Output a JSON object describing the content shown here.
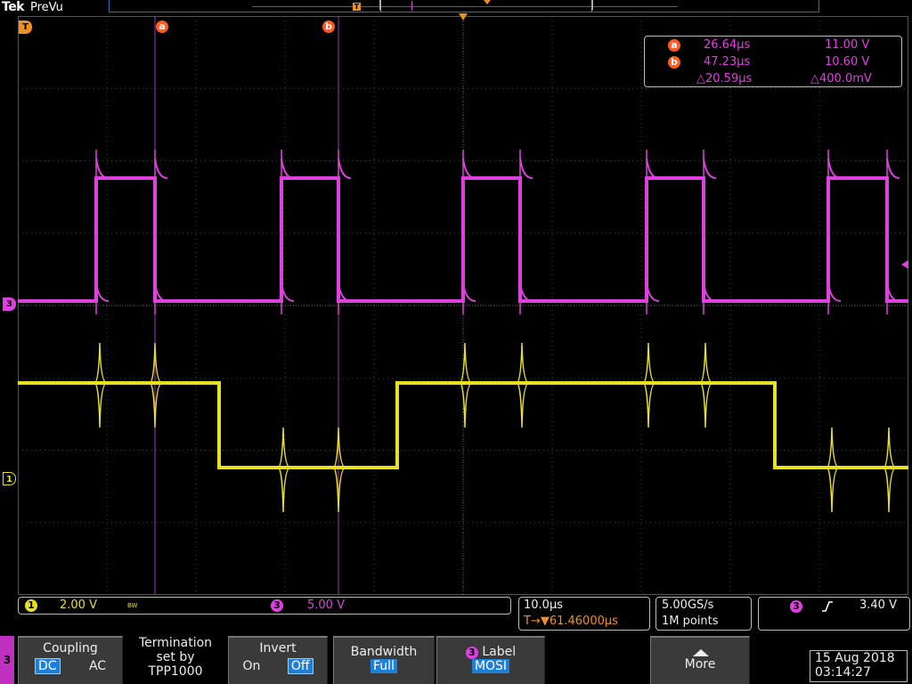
{
  "header": {
    "brand": "Tek",
    "mode": "PreVu"
  },
  "markers": {
    "trigger_symbol": "T",
    "ch3": "3",
    "ch1": "1",
    "cursor_a": "a",
    "cursor_b": "b"
  },
  "cursor_readout": {
    "a_time": "26.64µs",
    "a_volt": "11.00 V",
    "b_time": "47.23µs",
    "b_volt": "10.60 V",
    "delta_time": "△20.59µs",
    "delta_volt": "△400.0mV"
  },
  "status": {
    "ch1_num": "1",
    "ch1_scale": "2.00 V",
    "ch1_bw": "BW",
    "ch3_num": "3",
    "ch3_scale": "5.00 V",
    "timebase": "10.0µs",
    "trigger_pos": "T→▼61.46000µs",
    "sample_rate": "5.00GS/s",
    "record_length": "1M points",
    "trig_source": "3",
    "trig_level": "3.40 V"
  },
  "menu": {
    "channel": "3",
    "coupling_label": "Coupling",
    "coupling_dc": "DC",
    "coupling_ac": "AC",
    "termination_l1": "Termination",
    "termination_l2": "set by",
    "termination_l3": "TPP1000",
    "invert_label": "Invert",
    "invert_on": "On",
    "invert_off": "Off",
    "bandwidth_label": "Bandwidth",
    "bandwidth_value": "Full",
    "label_ch": "3",
    "label_label": "Label",
    "label_value": "MOSI",
    "more_label": "More"
  },
  "datetime": {
    "date": "15 Aug 2018",
    "time": "03:14:27"
  },
  "colors": {
    "ch1": "#e8e020",
    "ch3": "#e040e0",
    "cursor": "#ff5a1f",
    "accent": "#1e7fd8"
  }
}
